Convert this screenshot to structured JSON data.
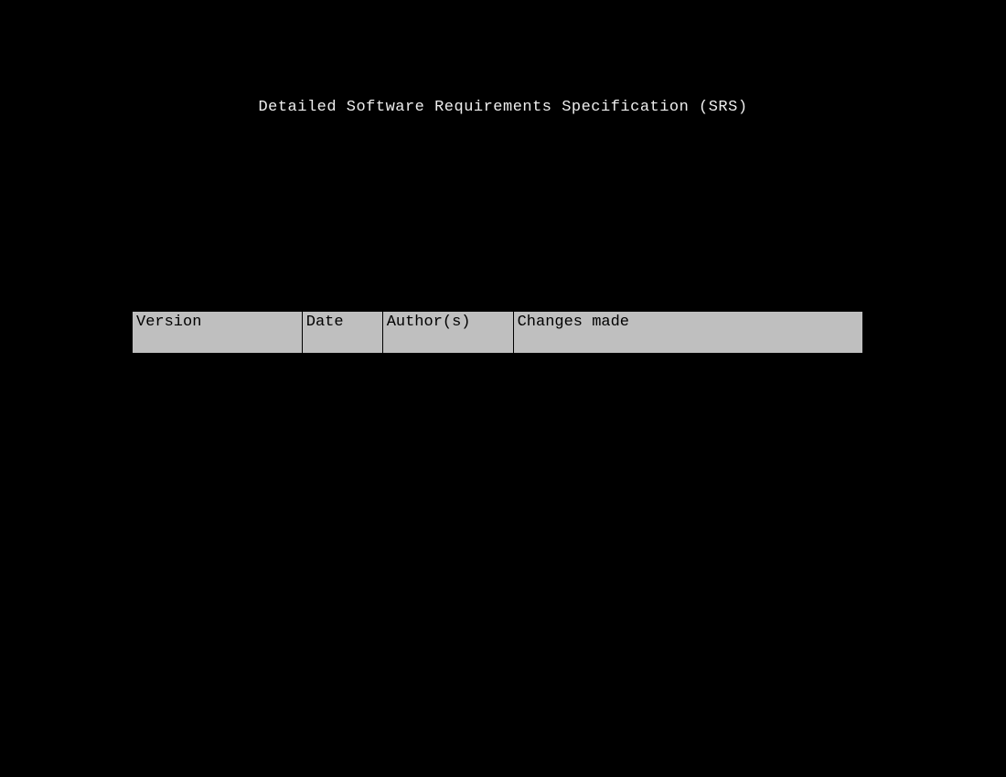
{
  "title": "Detailed Software Requirements Specification (SRS)",
  "table": {
    "headers": {
      "version": "Version",
      "date": "Date",
      "author": "Author(s)",
      "changes": "Changes made"
    }
  }
}
